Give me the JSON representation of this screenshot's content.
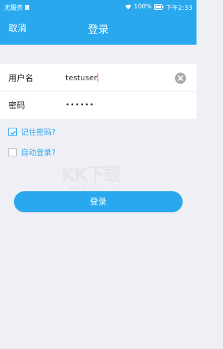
{
  "status_bar": {
    "carrier": "无服务",
    "battery_percent": "100%",
    "time": "下午2:33"
  },
  "nav": {
    "cancel_label": "取消",
    "title": "登录"
  },
  "form": {
    "username_label": "用户名",
    "username_value": "testuser",
    "password_label": "密码",
    "password_value": "••••••"
  },
  "options": {
    "remember_label": "记住密码?",
    "remember_checked": true,
    "autologin_label": "自动登录?",
    "autologin_checked": false
  },
  "login_button_label": "登录",
  "watermark": {
    "text": "KK下载",
    "subtext": "www.kkx.net"
  },
  "colors": {
    "brand": "#29a8ee",
    "background": "#eff0f5"
  }
}
